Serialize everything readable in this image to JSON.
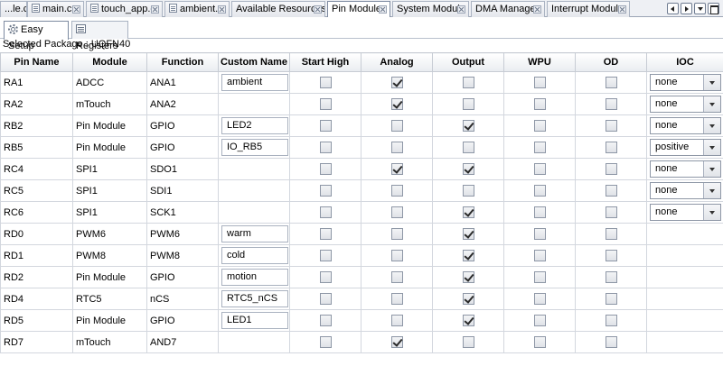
{
  "tabs": [
    {
      "label": "...le.c"
    },
    {
      "label": "main.c"
    },
    {
      "label": "touch_app.c"
    },
    {
      "label": "ambient.c"
    },
    {
      "label": "Available Resources"
    },
    {
      "label": "Pin Module"
    },
    {
      "label": "System Module"
    },
    {
      "label": "DMA Manager"
    },
    {
      "label": "Interrupt Module"
    }
  ],
  "active_tab": "Pin Module",
  "subtabs": [
    {
      "label": "Easy Setup",
      "icon": "gear-icon"
    },
    {
      "label": "Registers",
      "icon": "grid-icon"
    }
  ],
  "package": "Selected Package : UQFN40",
  "table": {
    "headers": [
      "Pin Name",
      "Module",
      "Function",
      "Custom Name",
      "Start High",
      "Analog",
      "Output",
      "WPU",
      "OD",
      "IOC"
    ],
    "rows": [
      {
        "pin": "RA1",
        "module": "ADCC",
        "function": "ANA1",
        "custom": "ambient",
        "start_high": false,
        "analog": true,
        "output": false,
        "wpu": false,
        "od": false,
        "ioc": "none"
      },
      {
        "pin": "RA2",
        "module": "mTouch",
        "function": "ANA2",
        "custom": "",
        "start_high": false,
        "analog": true,
        "output": false,
        "wpu": false,
        "od": false,
        "ioc": "none"
      },
      {
        "pin": "RB2",
        "module": "Pin Module",
        "function": "GPIO",
        "custom": "LED2",
        "start_high": false,
        "analog": false,
        "output": true,
        "wpu": false,
        "od": false,
        "ioc": "none"
      },
      {
        "pin": "RB5",
        "module": "Pin Module",
        "function": "GPIO",
        "custom": "IO_RB5",
        "start_high": false,
        "analog": false,
        "output": false,
        "wpu": false,
        "od": false,
        "ioc": "positive"
      },
      {
        "pin": "RC4",
        "module": "SPI1",
        "function": "SDO1",
        "custom": "",
        "start_high": false,
        "analog": true,
        "output": true,
        "wpu": false,
        "od": false,
        "ioc": "none"
      },
      {
        "pin": "RC5",
        "module": "SPI1",
        "function": "SDI1",
        "custom": "",
        "start_high": false,
        "analog": false,
        "output": false,
        "wpu": false,
        "od": false,
        "ioc": "none"
      },
      {
        "pin": "RC6",
        "module": "SPI1",
        "function": "SCK1",
        "custom": "",
        "start_high": false,
        "analog": false,
        "output": true,
        "wpu": false,
        "od": false,
        "ioc": "none"
      },
      {
        "pin": "RD0",
        "module": "PWM6",
        "function": "PWM6",
        "custom": "warm",
        "start_high": false,
        "analog": false,
        "output": true,
        "wpu": false,
        "od": false,
        "ioc": ""
      },
      {
        "pin": "RD1",
        "module": "PWM8",
        "function": "PWM8",
        "custom": "cold",
        "start_high": false,
        "analog": false,
        "output": true,
        "wpu": false,
        "od": false,
        "ioc": ""
      },
      {
        "pin": "RD2",
        "module": "Pin Module",
        "function": "GPIO",
        "custom": "motion",
        "start_high": false,
        "analog": false,
        "output": true,
        "wpu": false,
        "od": false,
        "ioc": ""
      },
      {
        "pin": "RD4",
        "module": "RTC5",
        "function": "nCS",
        "custom": "RTC5_nCS",
        "start_high": false,
        "analog": false,
        "output": true,
        "wpu": false,
        "od": false,
        "ioc": ""
      },
      {
        "pin": "RD5",
        "module": "Pin Module",
        "function": "GPIO",
        "custom": "LED1",
        "start_high": false,
        "analog": false,
        "output": true,
        "wpu": false,
        "od": false,
        "ioc": ""
      },
      {
        "pin": "RD7",
        "module": "mTouch",
        "function": "AND7",
        "custom": "",
        "start_high": false,
        "analog": true,
        "output": false,
        "wpu": false,
        "od": false,
        "ioc": ""
      }
    ]
  }
}
